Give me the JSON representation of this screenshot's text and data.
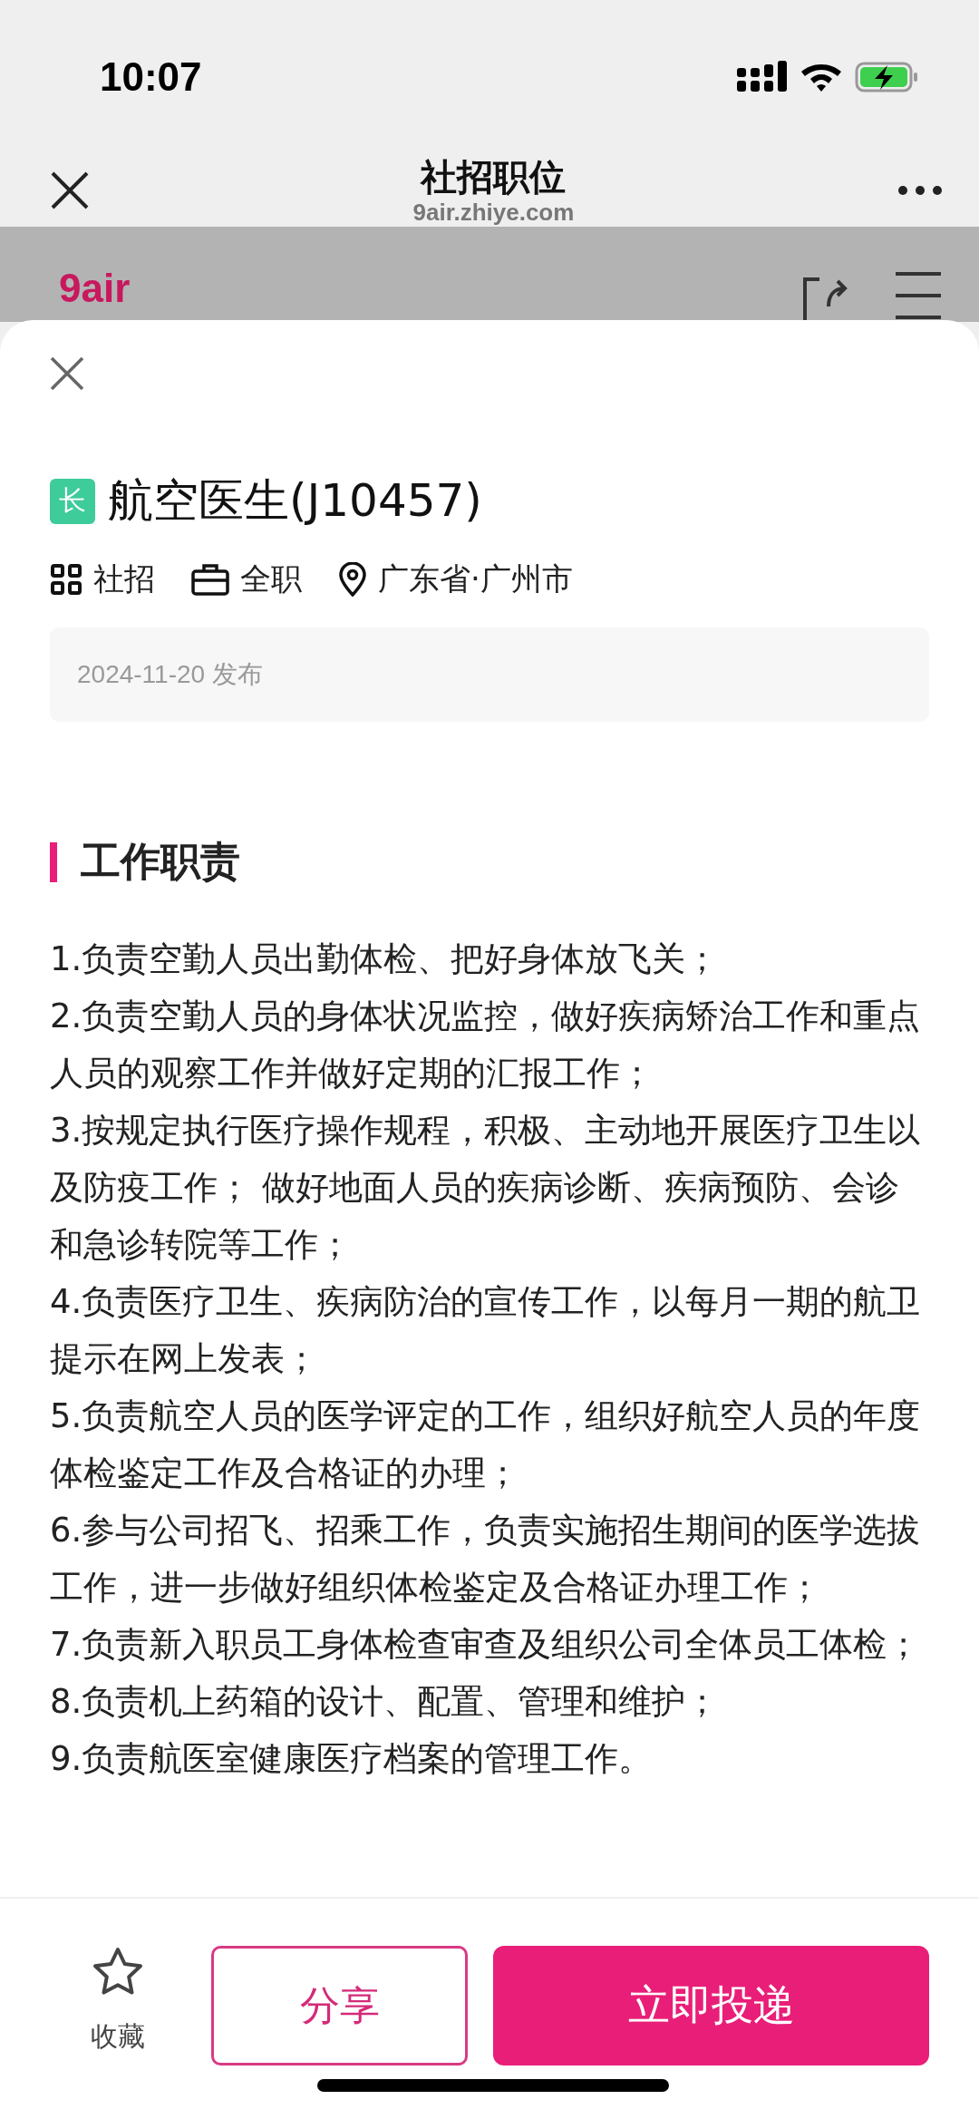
{
  "status_bar": {
    "time": "10:07"
  },
  "browser_bar": {
    "title": "社招职位",
    "url": "9air.zhiye.com"
  },
  "site_header": {
    "logo": "9air"
  },
  "job": {
    "badge": "长",
    "title": "航空医生(J10457)",
    "meta": [
      {
        "kind": "grid",
        "text": "社招"
      },
      {
        "kind": "briefcase",
        "text": "全职"
      },
      {
        "kind": "location",
        "text": "广东省·广州市"
      }
    ],
    "published": "2024-11-20 发布"
  },
  "section": {
    "heading": "工作职责",
    "items": [
      "1.负责空勤人员出勤体检、把好身体放飞关；",
      "2.负责空勤人员的身体状况监控，做好疾病矫治工作和重点人员的观察工作并做好定期的汇报工作；",
      "3.按规定执行医疗操作规程，积极、主动地开展医疗卫生以及防疫工作； 做好地面人员的疾病诊断、疾病预防、会诊和急诊转院等工作；",
      "4.负责医疗卫生、疾病防治的宣传工作，以每月一期的航卫提示在网上发表；",
      "5.负责航空人员的医学评定的工作，组织好航空人员的年度体检鉴定工作及合格证的办理；",
      "6.参与公司招飞、招乘工作，负责实施招生期间的医学选拔工作，进一步做好组织体检鉴定及合格证办理工作；",
      "7.负责新入职员工身体检查审查及组织公司全体员工体检；",
      "8.负责机上药箱的设计、配置、管理和维护；",
      "9.负责航医室健康医疗档案的管理工作。"
    ]
  },
  "bottom_bar": {
    "favorite": "收藏",
    "share": "分享",
    "apply": "立即投递"
  }
}
